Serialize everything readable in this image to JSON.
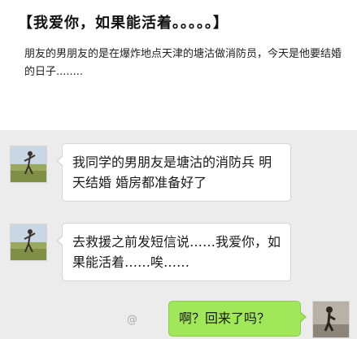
{
  "article": {
    "title": "【我爱你，如果能活着。。。。。】",
    "intro": "朋友的男朋友的是在爆炸地点天津的塘沽做消防员，今天是他要结婚的日子........"
  },
  "chat": {
    "messages": [
      {
        "sender": "friend",
        "text": "我同学的男朋友是塘沽的消防兵 明天结婚 婚房都准备好了"
      },
      {
        "sender": "friend",
        "text": "去救援之前发短信说……我爱你，如果能活着……唉……"
      },
      {
        "sender": "me",
        "text": "啊？回来了吗？"
      }
    ],
    "watermark": "@"
  },
  "colors": {
    "chat_background": "#ececec",
    "received_bubble": "#ffffff",
    "sent_bubble": "#a0e75a"
  },
  "icons": {
    "friend_avatar": "person-on-field-avatar",
    "my_avatar": "person-photo-avatar"
  }
}
